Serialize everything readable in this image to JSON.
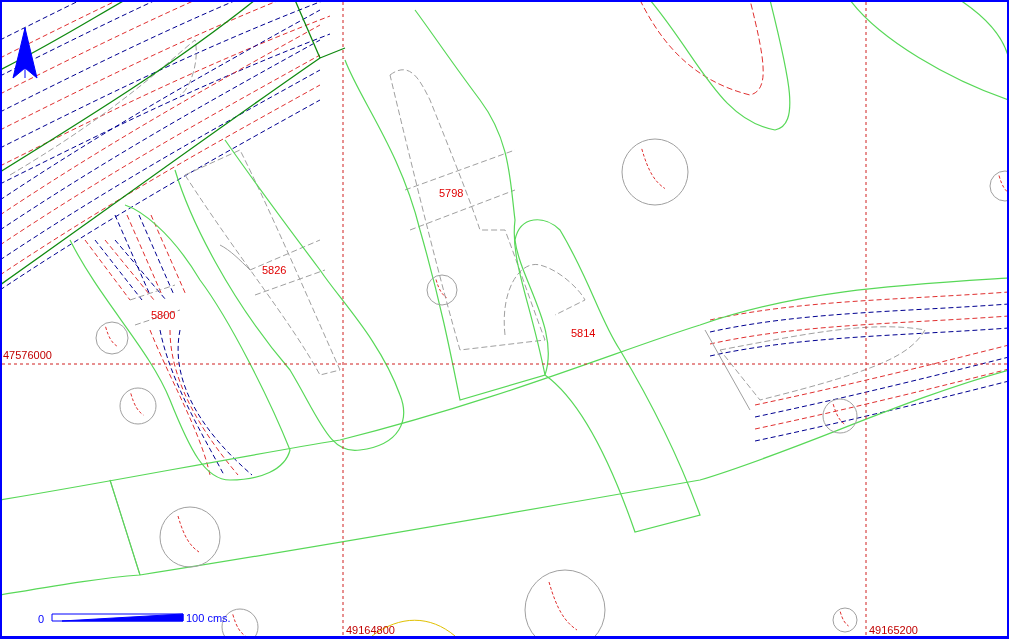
{
  "map": {
    "parcels": [
      {
        "label": "5798"
      },
      {
        "label": "5826"
      },
      {
        "label": "5800"
      },
      {
        "label": "5814"
      }
    ],
    "grid": {
      "northing": "47576000",
      "eastings": [
        "49164800",
        "49165200"
      ]
    },
    "scale_bar": {
      "start": "0",
      "end": "100",
      "unit": "cms."
    }
  }
}
